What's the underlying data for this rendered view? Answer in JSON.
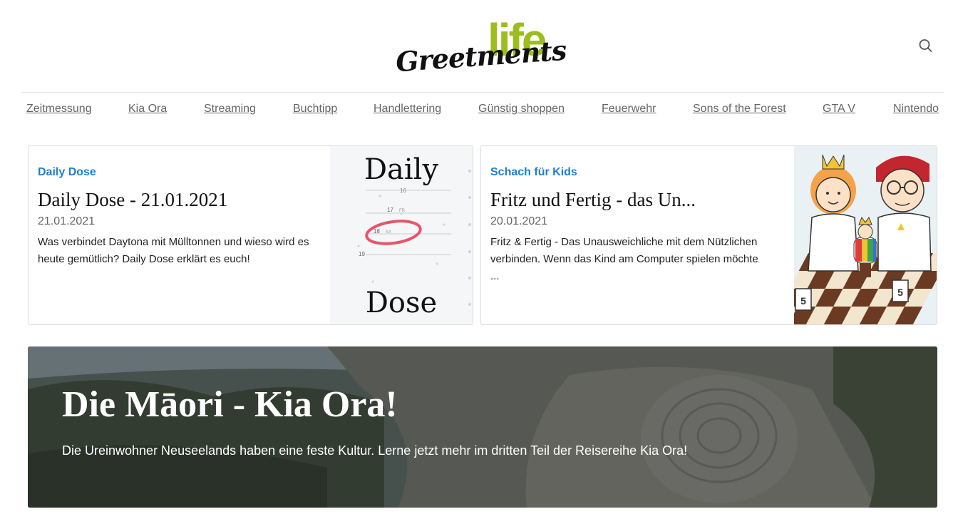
{
  "header": {
    "logo_main": "Greetments",
    "logo_accent": "life",
    "search_icon": "search-icon"
  },
  "nav": {
    "items": [
      {
        "label": "Zeitmessung"
      },
      {
        "label": "Kia Ora"
      },
      {
        "label": "Streaming"
      },
      {
        "label": "Buchtipp"
      },
      {
        "label": "Handlettering"
      },
      {
        "label": "Günstig shoppen"
      },
      {
        "label": "Feuerwehr"
      },
      {
        "label": "Sons of the Forest"
      },
      {
        "label": "GTA V"
      },
      {
        "label": "Nintendo"
      }
    ]
  },
  "cards": [
    {
      "category": "Daily Dose",
      "title": "Daily Dose - 21.01.2021",
      "date": "21.01.2021",
      "text": "Was verbindet Daytona mit Mülltonnen und wieso wird es heute gemütlich? Daily Dose erklärt es euch!",
      "image": {
        "word_top": "Daily",
        "word_bottom": "Dose",
        "cal_17": "17",
        "cal_17d": "FR",
        "cal_18": "18",
        "cal_18d": "SA",
        "cal_19": "19",
        "cal_16": "16"
      }
    },
    {
      "category": "Schach für Kids",
      "title": "Fritz und Fertig - das Un...",
      "date": "20.01.2021",
      "text": "Fritz & Fertig - Das Unausweichliche mit dem Nützlichen verbinden. Wenn das Kind am Computer spielen möchte ...",
      "image": {
        "piece_number": "5"
      }
    }
  ],
  "hero": {
    "title": "Die Māori - Kia Ora!",
    "subtitle": "Die Ureinwohner Neuseelands haben eine feste Kultur. Lerne jetzt mehr im dritten Teil der Reisereihe Kia Ora!"
  },
  "colors": {
    "accent_blue": "#1e7fd1",
    "logo_green": "#9bbe1e",
    "calendar_ring": "#e8546a"
  }
}
